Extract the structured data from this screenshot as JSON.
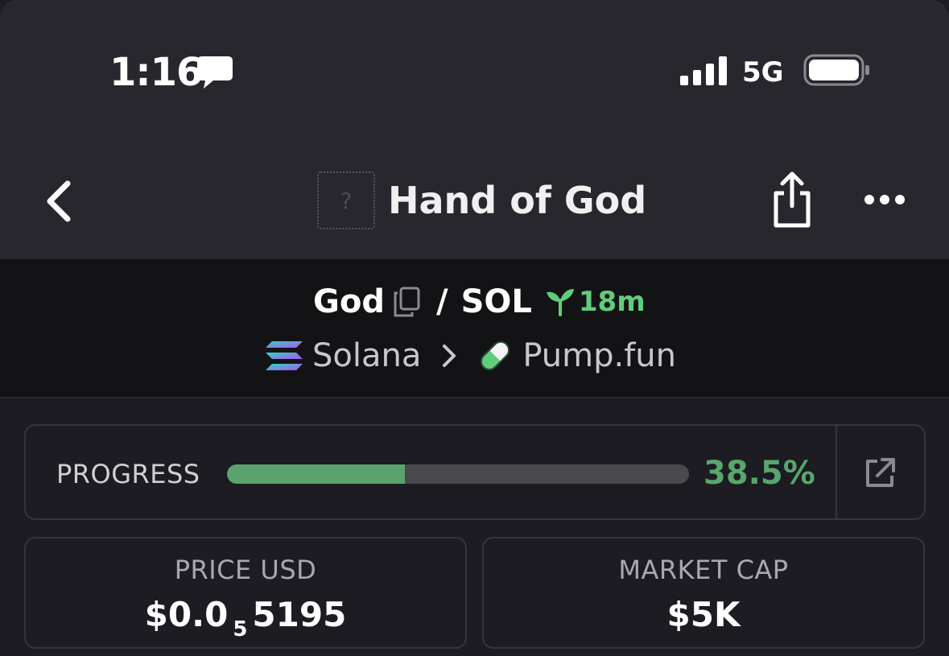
{
  "status_bar": {
    "time": "1:16",
    "network": "5G"
  },
  "nav": {
    "token_placeholder": "?",
    "title": "Hand of God"
  },
  "pair": {
    "base": "God",
    "separator": "/",
    "quote": "SOL",
    "age": "18m",
    "chain": "Solana",
    "dex": "Pump.fun"
  },
  "progress": {
    "label": "PROGRESS",
    "percent_text": "38.5%",
    "value": 38.5
  },
  "stats": {
    "price": {
      "label": "PRICE USD",
      "prefix": "$0.0",
      "zeros": "5",
      "digits": "5195"
    },
    "market_cap": {
      "label": "MARKET CAP",
      "value": "$5K"
    }
  },
  "colors": {
    "accent_green": "#5aa36e",
    "age_green": "#5fce7c",
    "background": "#1c1c22",
    "header": "#27272d"
  },
  "icons": [
    "message-icon",
    "signal-icon",
    "battery-icon",
    "back-icon",
    "share-icon",
    "more-icon",
    "copy-icon",
    "sprout-icon",
    "solana-icon",
    "chevron-right-icon",
    "pill-icon",
    "external-link-icon"
  ]
}
